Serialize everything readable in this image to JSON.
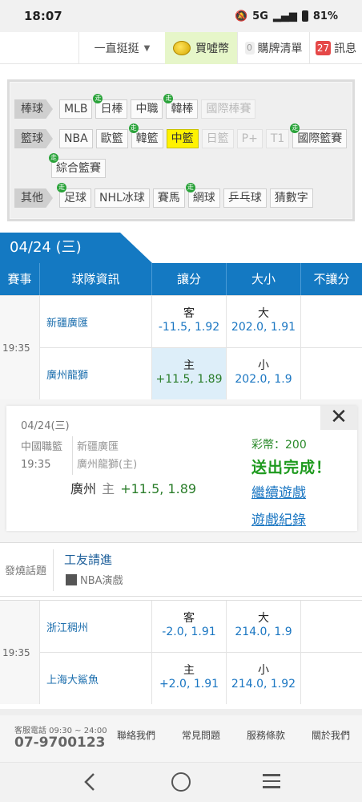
{
  "status_bar": {
    "time": "18:07",
    "network": "5G",
    "battery": "81%"
  },
  "top_nav": {
    "sort": "一直挺挺",
    "buy_coins": "買噓幣",
    "bet_count": "0",
    "bet_list": "購牌清單",
    "msg_count": "27",
    "messages": "訊息"
  },
  "sport_filter": {
    "rows": [
      {
        "category": "棒球",
        "items": [
          {
            "label": "MLB",
            "live": false,
            "state": "normal"
          },
          {
            "label": "日棒",
            "live": true,
            "state": "normal"
          },
          {
            "label": "中職",
            "live": false,
            "state": "normal"
          },
          {
            "label": "韓棒",
            "live": true,
            "state": "normal"
          },
          {
            "label": "國際棒賽",
            "live": false,
            "state": "dim"
          }
        ]
      },
      {
        "category": "籃球",
        "items": [
          {
            "label": "NBA",
            "live": false,
            "state": "normal"
          },
          {
            "label": "歐籃",
            "live": false,
            "state": "normal"
          },
          {
            "label": "韓籃",
            "live": true,
            "state": "normal"
          },
          {
            "label": "中籃",
            "live": false,
            "state": "active"
          },
          {
            "label": "日籃",
            "live": false,
            "state": "dim"
          },
          {
            "label": "P+",
            "live": false,
            "state": "dim"
          },
          {
            "label": "T1",
            "live": false,
            "state": "dim"
          },
          {
            "label": "國際籃賽",
            "live": true,
            "state": "normal"
          }
        ]
      },
      {
        "category": "",
        "items": [
          {
            "label": "綜合籃賽",
            "live": true,
            "state": "normal"
          }
        ]
      },
      {
        "category": "其他",
        "items": [
          {
            "label": "足球",
            "live": true,
            "state": "normal"
          },
          {
            "label": "NHL冰球",
            "live": false,
            "state": "normal"
          },
          {
            "label": "賽馬",
            "live": false,
            "state": "normal"
          },
          {
            "label": "網球",
            "live": true,
            "state": "normal"
          },
          {
            "label": "乒乓球",
            "live": false,
            "state": "normal"
          },
          {
            "label": "猜數字",
            "live": false,
            "state": "normal"
          }
        ]
      }
    ],
    "live_mark": "走"
  },
  "date": "04/24 (三)",
  "table_headers": [
    "賽事",
    "球隊資訊",
    "讓分",
    "大小",
    "不讓分"
  ],
  "games": [
    {
      "time": "19:35",
      "away": {
        "team": "新疆廣匯",
        "spread_label": "客",
        "spread": "-11.5, 1.92",
        "total_label": "大",
        "total": "202.0, 1.91"
      },
      "home": {
        "team": "廣州龍獅",
        "spread_label": "主",
        "spread": "+11.5, 1.89",
        "total_label": "小",
        "total": "202.0, 1.9"
      }
    },
    {
      "time": "19:35",
      "away": {
        "team": "浙江稠州",
        "spread_label": "客",
        "spread": "-2.0, 1.91",
        "total_label": "大",
        "total": "214.0, 1.9"
      },
      "home": {
        "team": "上海大鯊魚",
        "spread_label": "主",
        "spread": "+2.0, 1.91",
        "total_label": "小",
        "total": "214.0, 1.92"
      }
    }
  ],
  "bet_popup": {
    "date": "04/24(三)",
    "league": "中國職籃",
    "time": "19:35",
    "team1": "新疆廣匯",
    "team2": "廣州龍獅(主)",
    "pick_team": "廣州",
    "pick_side": "主",
    "pick_odds": "+11.5, 1.89",
    "coins": "彩幣：200",
    "status": "送出完成！",
    "continue": "繼續遊戲",
    "record": "遊戲紀錄",
    "close": "✕"
  },
  "discussion": {
    "label": "發燒話題",
    "title": "工友請進",
    "subtitle": "NBA演戲"
  },
  "footer": {
    "phone_label": "客服電話 09:30 ~ 24:00",
    "phone": "07-9700123",
    "links": [
      "聯絡我們",
      "常見問題",
      "服務條款",
      "關於我們"
    ]
  }
}
